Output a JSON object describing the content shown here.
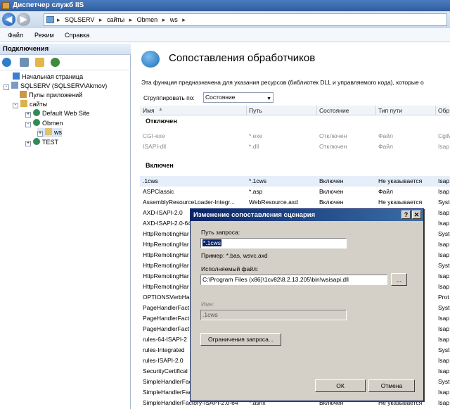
{
  "window": {
    "title": "Диспетчер служб IIS"
  },
  "address": {
    "crumbs": [
      "SQLSERV",
      "сайты",
      "Obmen",
      "ws"
    ],
    "separator": "▸"
  },
  "menu": {
    "items": [
      "Файл",
      "Режим",
      "Справка"
    ]
  },
  "connections": {
    "header": "Подключения",
    "tree": [
      {
        "label": "Начальная страница",
        "icon": "home-page-icon"
      },
      {
        "label": "SQLSERV (SQLSERV\\Akmov)",
        "icon": "server-icon",
        "expander": "-"
      },
      {
        "label": "Пулы приложений",
        "icon": "app-pools-icon"
      },
      {
        "label": "сайты",
        "icon": "sites-folder-icon",
        "expander": "-"
      },
      {
        "label": "Default Web Site",
        "icon": "globe-icon",
        "expander": "+"
      },
      {
        "label": "Obmen",
        "icon": "globe-icon",
        "expander": "-"
      },
      {
        "label": "ws",
        "icon": "folder-icon",
        "expander": "+"
      },
      {
        "label": "TEST",
        "icon": "globe-icon",
        "expander": "+"
      }
    ]
  },
  "main": {
    "title": "Сопоставления обработчиков",
    "description": "Эта функция предназначена для указания ресурсов (библиотек DLL и управляемого кода), которые о",
    "group_label": "Сгруппировать по:",
    "group_value": "Состояние",
    "columns": [
      "Имя",
      "Путь",
      "Состояние",
      "Тип пути",
      "Обр"
    ],
    "group_disabled": "Отключен",
    "group_enabled": "Включен",
    "disabled_rows": [
      [
        "CGI-exe",
        "*.exe",
        "Отключен",
        "Файл",
        "CgiM"
      ],
      [
        "ISAPI-dll",
        "*.dll",
        "Отключен",
        "Файл",
        "Isap"
      ]
    ],
    "enabled_rows": [
      [
        ".1cws",
        "*.1cws",
        "Включен",
        "Не указывается",
        "Isap"
      ],
      [
        "ASPClassic",
        "*.asp",
        "Включен",
        "Файл",
        "Isap"
      ],
      [
        "AssemblyResourceLoader-Integr...",
        "WebResource.axd",
        "Включен",
        "Не указывается",
        "Syst"
      ],
      [
        "AXD-ISAPI-2.0",
        "",
        "",
        "",
        "Isap"
      ],
      [
        "AXD-ISAPI-2.0-64",
        "",
        "",
        "",
        "Isap"
      ],
      [
        "HttpRemotingHar",
        "",
        "",
        "",
        "Syst"
      ],
      [
        "HttpRemotingHar",
        "",
        "",
        "",
        "Isap"
      ],
      [
        "HttpRemotingHar",
        "",
        "",
        "",
        "Isap"
      ],
      [
        "HttpRemotingHar",
        "",
        "",
        "",
        "Syst"
      ],
      [
        "HttpRemotingHar",
        "",
        "",
        "",
        "Isap"
      ],
      [
        "HttpRemotingHar",
        "",
        "",
        "",
        "Isap"
      ],
      [
        "OPTIONSVerbHa",
        "",
        "",
        "",
        "Prot"
      ],
      [
        "PageHandlerFact",
        "",
        "",
        "",
        "Syst"
      ],
      [
        "PageHandlerFact",
        "",
        "",
        "",
        "Isap"
      ],
      [
        "PageHandlerFact",
        "",
        "",
        "",
        "Isap"
      ],
      [
        "rules-64-ISAPI-2",
        "",
        "",
        "",
        "Isap"
      ],
      [
        "rules-Integrated",
        "",
        "",
        "",
        "Syst"
      ],
      [
        "rules-ISAPI-2.0",
        "",
        "",
        "",
        "Isap"
      ],
      [
        "SecurityCertifical",
        "",
        "",
        "",
        "Isap"
      ],
      [
        "SimpleHandlerFac",
        "",
        "",
        "",
        "Syst"
      ],
      [
        "SimpleHandlerFac",
        "",
        "",
        "",
        "Isap"
      ],
      [
        "SimpleHandlerFactory-ISAPI-2.0-64",
        "*.ashx",
        "Включен",
        "Не указывается",
        "Isap"
      ]
    ]
  },
  "dialog": {
    "title": "Изменение сопоставления сценария",
    "help_button": "?",
    "close_button": "✕",
    "request_path_label": "Путь запроса:",
    "request_path_value": "*.1cws",
    "example": "Пример: *.bas, wsvc.axd",
    "executable_label": "Исполняемый файл:",
    "executable_value": "C:\\Program Files (x86)\\1cv82\\8.2.13.205\\bin\\wsisapi.dll",
    "browse_button": "...",
    "name_label": "Имя:",
    "name_value": ".1cws",
    "restrictions_button": "Ограничения запроса...",
    "ok_button": "ОК",
    "cancel_button": "Отмена"
  }
}
